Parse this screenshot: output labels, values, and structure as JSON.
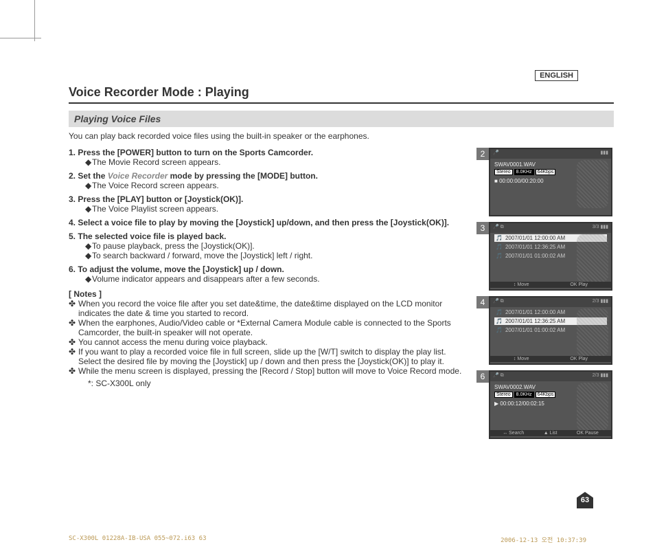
{
  "language": "ENGLISH",
  "title": "Voice Recorder Mode : Playing",
  "subtitle": "Playing Voice Files",
  "intro": "You can play back recorded voice files using the built-in speaker or the earphones.",
  "steps": [
    {
      "num": "1.",
      "head": "Press the [POWER] button to turn on the Sports Camcorder.",
      "subs": [
        "The Movie Record screen appears."
      ]
    },
    {
      "num": "2.",
      "head_pre": "Set the ",
      "head_em": "Voice Recorder",
      "head_post": " mode by pressing the [MODE] button.",
      "subs": [
        "The Voice Record screen appears."
      ]
    },
    {
      "num": "3.",
      "head": "Press the [PLAY] button or [Joystick(OK)].",
      "subs": [
        "The Voice Playlist screen appears."
      ]
    },
    {
      "num": "4.",
      "head": "Select a voice file to play by moving the [Joystick] up/down, and then press the [Joystick(OK)].",
      "subs": []
    },
    {
      "num": "5.",
      "head": "The selected voice file is played back.",
      "subs": [
        "To pause playback, press the [Joystick(OK)].",
        "To search backward / forward, move the [Joystick] left / right."
      ]
    },
    {
      "num": "6.",
      "head": "To adjust the volume, move the [Joystick] up / down.",
      "subs": [
        "Volume indicator appears and disappears after a few seconds."
      ]
    }
  ],
  "notes_label": "[ Notes ]",
  "notes": [
    "When you record the voice file after you set date&time, the date&time displayed on the LCD monitor indicates the date & time you started to record.",
    "When the earphones, Audio/Video cable or *External Camera Module cable is connected to the Sports Camcorder, the built-in speaker will not operate.",
    "You cannot access the menu during voice playback.",
    "If you want to play a recorded voice file in full screen, slide up the [W/T] switch to display the play list. Select the desired file by moving the [Joystick] up / down and then press the [Joystick(OK)] to play it.",
    "While the menu screen is displayed, pressing the [Record / Stop] button will move to Voice Record mode."
  ],
  "footnote": "*: SC-X300L only",
  "page_number": "63",
  "footer_left": "SC-X300L 01228A-IB-USA 055~072.i63   63",
  "footer_right": "2006-12-13   오전 10:37:39",
  "screens": {
    "s2": {
      "num": "2",
      "file": "SWAV0001.WAV",
      "badges": [
        "Stereo",
        "8.0KHz",
        "64Kbps"
      ],
      "time": "00:00:00/00:20:00"
    },
    "s3": {
      "num": "3",
      "counter": "3/3",
      "rows": [
        {
          "date": "2007/01/01 12:00:00 AM",
          "sel": true
        },
        {
          "date": "2007/01/01 12:36:25 AM",
          "sel": false
        },
        {
          "date": "2007/01/01 01:00:02 AM",
          "sel": false
        }
      ],
      "hints": [
        "Move",
        "Play"
      ],
      "hint_icons": [
        "↕",
        "OK"
      ]
    },
    "s4": {
      "num": "4",
      "counter": "2/3",
      "rows": [
        {
          "date": "2007/01/01 12:00:00 AM",
          "sel": false
        },
        {
          "date": "2007/01/01 12:36:25 AM",
          "sel": true
        },
        {
          "date": "2007/01/01 01:00:02 AM",
          "sel": false
        }
      ],
      "hints": [
        "Move",
        "Play"
      ],
      "hint_icons": [
        "↕",
        "OK"
      ]
    },
    "s6": {
      "num": "6",
      "counter": "2/3",
      "file": "SWAV0002.WAV",
      "badges": [
        "Stereo",
        "8.0KHz",
        "64Kbps"
      ],
      "time": "00:00:12/00:02:15",
      "hints": [
        "Search",
        "List",
        "Pause"
      ],
      "hint_icons": [
        "↔",
        "▲",
        "OK"
      ]
    }
  }
}
